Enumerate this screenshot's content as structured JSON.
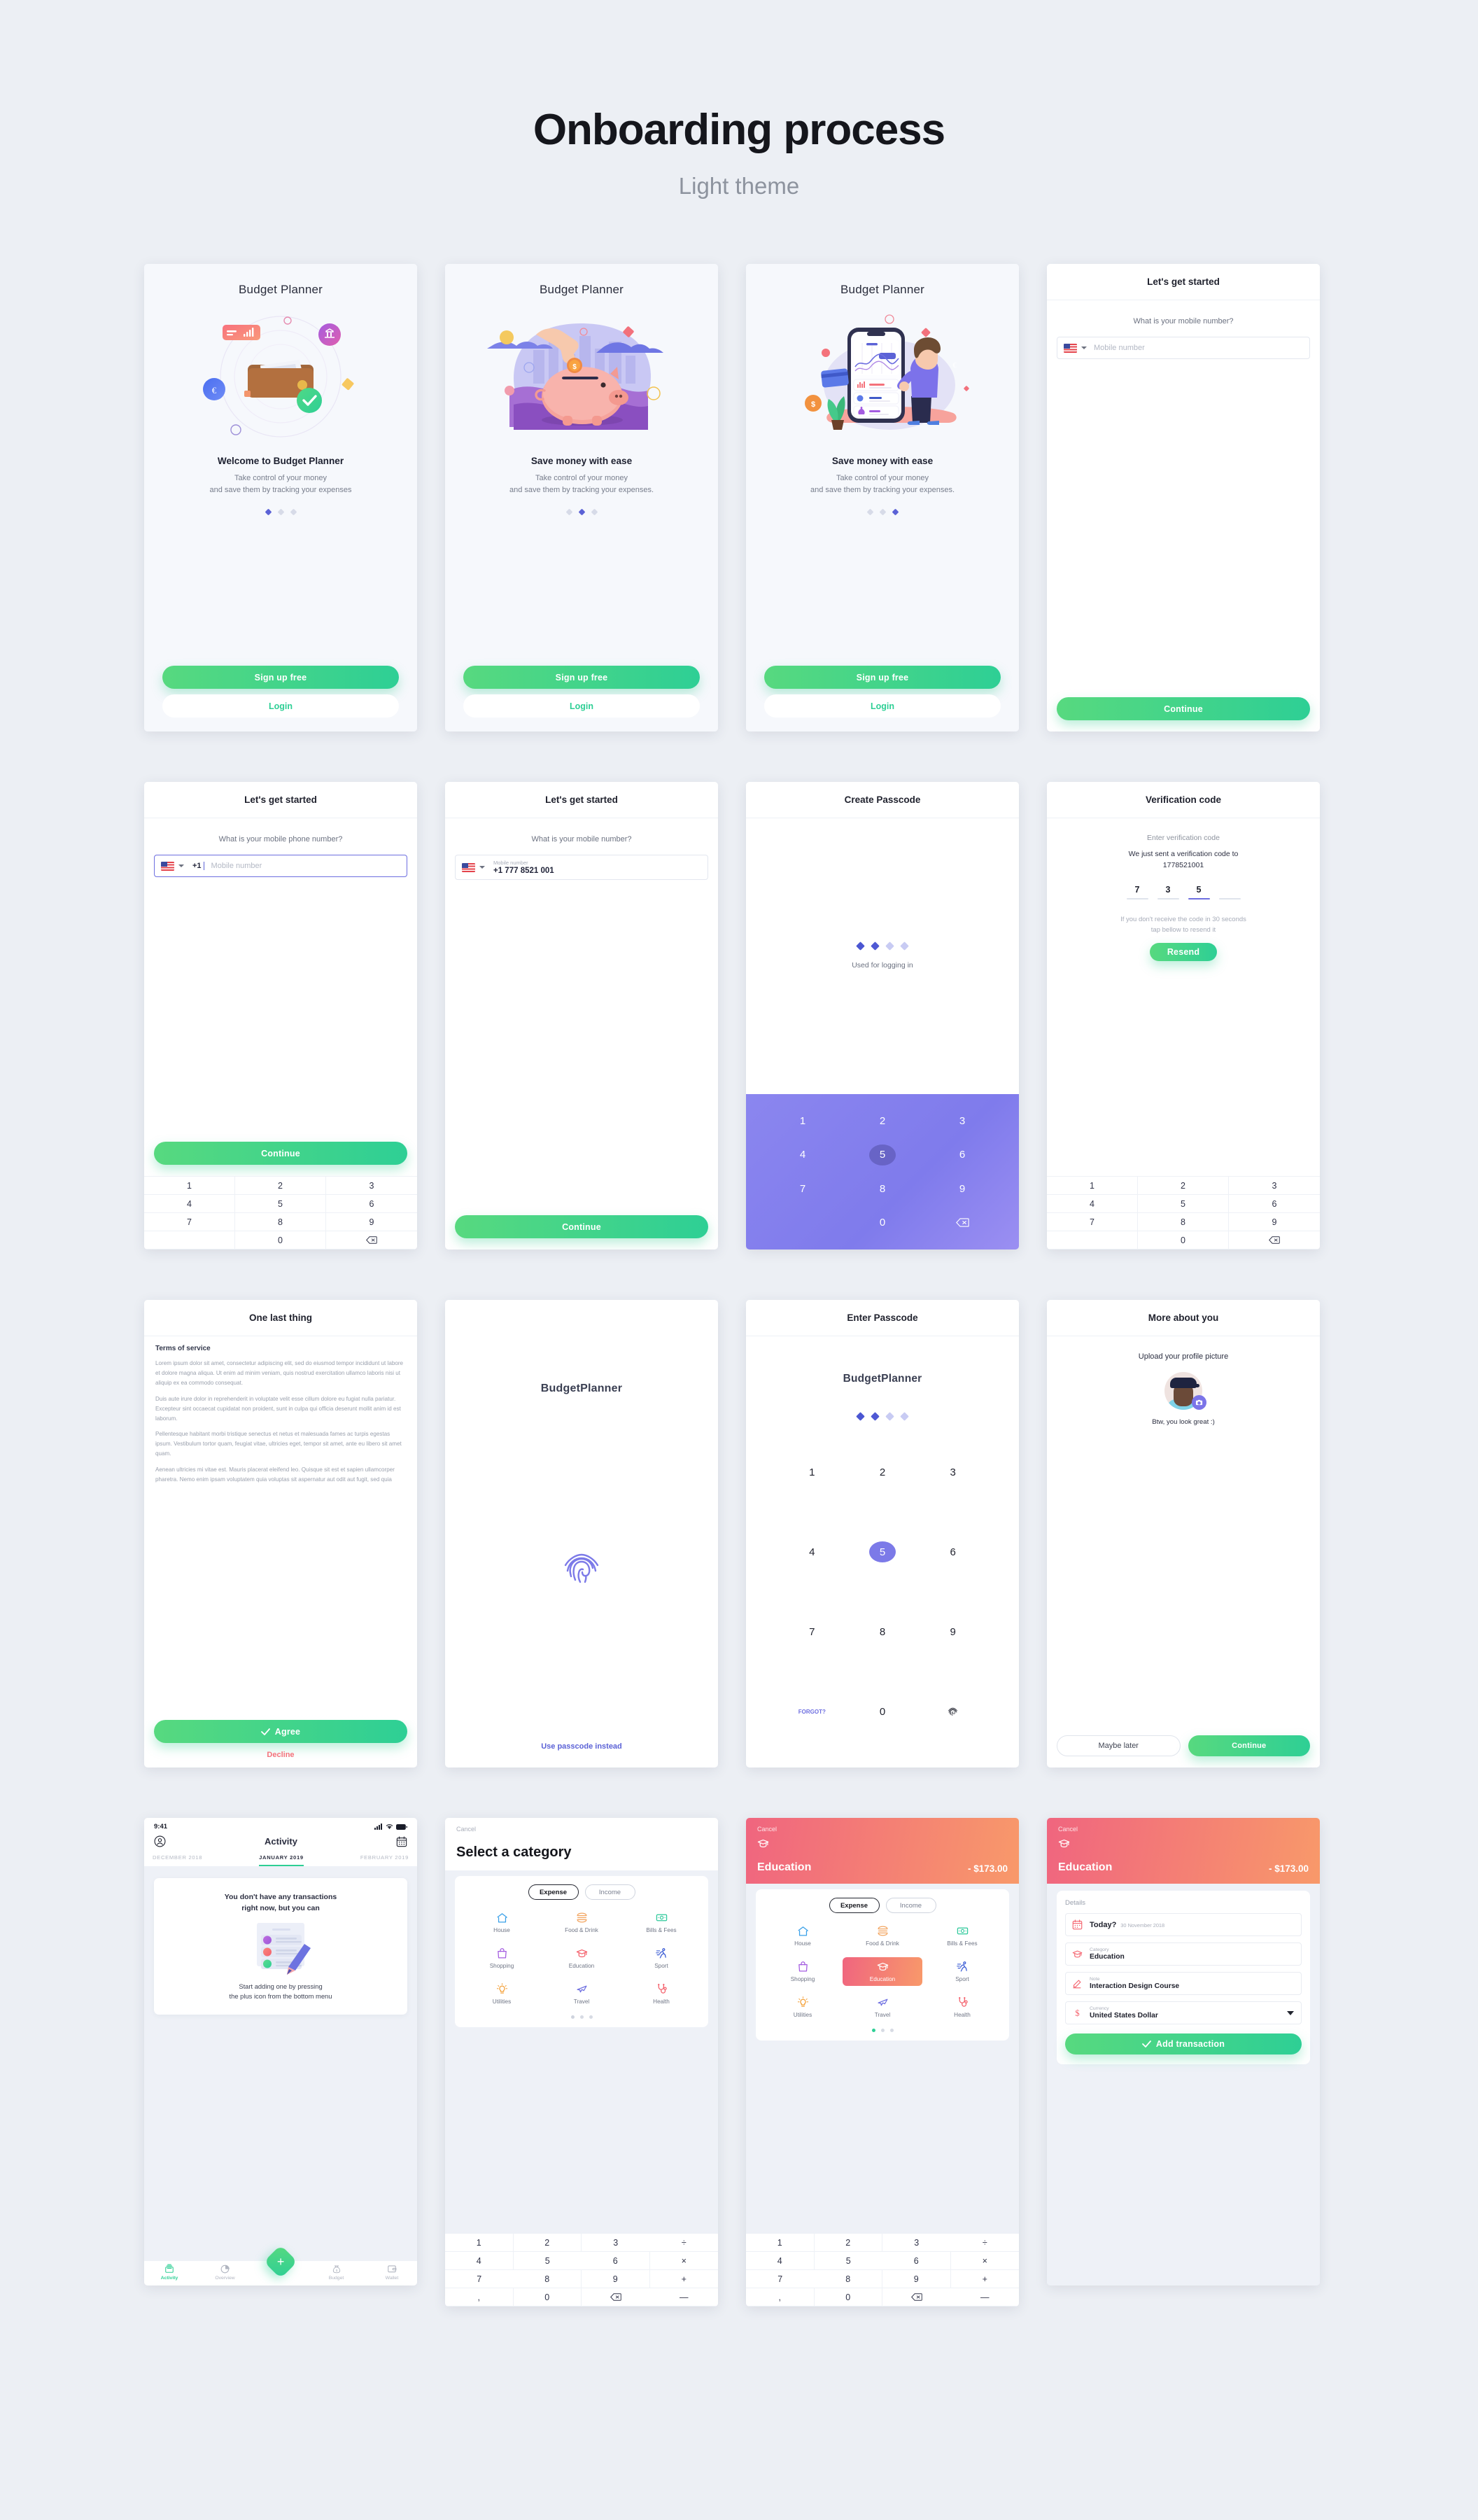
{
  "page": {
    "title": "Onboarding process",
    "subtitle": "Light theme"
  },
  "common": {
    "brand": "Budget Planner",
    "brand_compact": "BudgetPlanner",
    "signup_label": "Sign up free",
    "login_label": "Login",
    "continue_label": "Continue",
    "mobile_placeholder": "Mobile number",
    "mobile_label": "Mobile number",
    "country_code": "+1",
    "accent_green": "#2ecf95",
    "accent_purple": "#6d6ee0",
    "accent_red": "#f4727b"
  },
  "onboarding": [
    {
      "title": "Budget Planner",
      "heading": "Welcome to Budget Planner",
      "body_line1": "Take control of your money",
      "body_line2": "and save them by tracking your expenses",
      "active_dot": 0
    },
    {
      "title": "Budget Planner",
      "heading": "Save money with ease",
      "body_line1": "Take control of your money",
      "body_line2": "and save them by tracking your expenses.",
      "active_dot": 1
    },
    {
      "title": "Budget Planner",
      "heading": "Save money with ease",
      "body_line1": "Take control of your money",
      "body_line2": "and save them by tracking your expenses.",
      "active_dot": 2
    }
  ],
  "get_started_empty": {
    "navbar": "Let's get started",
    "question": "What is your mobile number?",
    "placeholder": "Mobile number",
    "cta": "Continue"
  },
  "get_started_typing": {
    "navbar": "Let's get started",
    "question": "What is your mobile phone number?",
    "prefix": "+1",
    "placeholder": "Mobile number",
    "cta": "Continue"
  },
  "get_started_filled": {
    "navbar": "Let's get started",
    "question": "What is your mobile number?",
    "field_label": "Mobile number",
    "field_value": "+1 777 8521 001",
    "cta": "Continue"
  },
  "create_passcode": {
    "navbar": "Create Passcode",
    "hint": "Used for logging in",
    "filled_dots": 2,
    "total_dots": 4,
    "pressed_key": "5"
  },
  "verification": {
    "navbar": "Verification code",
    "subtitle": "Enter verification code",
    "sent_line1": "We just sent a verification code to",
    "sent_line2": "1778521001",
    "digits": [
      "7",
      "3",
      "5",
      ""
    ],
    "active_index": 2,
    "note_line1": "If you don't receive the code in 30 seconds",
    "note_line2": "tap bellow to resend it",
    "resend_label": "Resend"
  },
  "terms": {
    "navbar": "One last thing",
    "heading": "Terms of service",
    "paragraphs": [
      "Lorem ipsum dolor sit amet, consectetur adipiscing elit, sed do eiusmod tempor incididunt ut labore et dolore magna aliqua. Ut enim ad minim veniam, quis nostrud exercitation ullamco laboris nisi ut aliquip ex ea commodo consequat.",
      "Duis aute irure dolor in reprehenderit in voluptate velit esse cillum dolore eu fugiat nulla pariatur. Excepteur sint occaecat cupidatat non proident, sunt in culpa qui officia deserunt mollit anim id est laborum.",
      "Pellentesque habitant morbi tristique senectus et netus et malesuada fames ac turpis egestas ipsum. Vestibulum tortor quam, feugiat vitae, ultricies eget, tempor sit amet, ante eu libero sit amet quam.",
      "Aenean ultricies mi vitae est. Mauris placerat eleifend leo. Quisque sit est et sapien ullamcorper pharetra. Nemo enim ipsam voluptatem quia voluptas sit aspernatur aut odit aut fugit, sed quia"
    ],
    "agree_label": "Agree",
    "decline_label": "Decline"
  },
  "fingerprint": {
    "brand": "BudgetPlanner",
    "link": "Use passcode instead"
  },
  "enter_passcode": {
    "navbar": "Enter Passcode",
    "brand": "BudgetPlanner",
    "filled_dots": 2,
    "total_dots": 4,
    "forgot_label": "FORGOT?",
    "pressed_key": "5"
  },
  "profile": {
    "navbar": "More about you",
    "prompt": "Upload your profile picture",
    "caption": "Btw, you look great :)",
    "secondary_cta": "Maybe later",
    "primary_cta": "Continue"
  },
  "activity": {
    "status_time": "9:41",
    "title": "Activity",
    "months": [
      "DECEMBER 2018",
      "JANUARY 2019",
      "FEBRUARY 2019"
    ],
    "active_month_index": 1,
    "empty_heading_line1": "You don't have any transactions",
    "empty_heading_line2": "right now, but you can",
    "empty_body_line1": "Start adding one by pressing",
    "empty_body_line2": "the plus icon from the bottom menu",
    "tabs": [
      "Activity",
      "Overview",
      "Budget",
      "Wallet"
    ],
    "active_tab_index": 0
  },
  "category_screen": {
    "cancel": "Cancel",
    "title": "Select a category",
    "segments": [
      "Expense",
      "Income"
    ],
    "active_segment": 0,
    "categories": [
      "House",
      "Food & Drink",
      "Bills & Fees",
      "Shopping",
      "Education",
      "Sport",
      "Utilities",
      "Travel",
      "Health"
    ],
    "selected_category": null,
    "page_count": 3,
    "active_page": 0,
    "keypad": [
      "1",
      "2",
      "3",
      "÷",
      "4",
      "5",
      "6",
      "×",
      "7",
      "8",
      "9",
      "+",
      ",",
      "0",
      "⌫",
      "—"
    ]
  },
  "category_selected_screen": {
    "cancel": "Cancel",
    "category_name": "Education",
    "amount": "- $173.00",
    "segments": [
      "Expense",
      "Income"
    ],
    "active_segment": 0,
    "categories": [
      "House",
      "Food & Drink",
      "Bills & Fees",
      "Shopping",
      "Education",
      "Sport",
      "Utilities",
      "Travel",
      "Health"
    ],
    "selected_category": "Education",
    "page_count": 3,
    "active_page": 0,
    "keypad": [
      "1",
      "2",
      "3",
      "÷",
      "4",
      "5",
      "6",
      "×",
      "7",
      "8",
      "9",
      "+",
      ",",
      "0",
      "⌫",
      "—"
    ]
  },
  "details_screen": {
    "cancel": "Cancel",
    "category_name": "Education",
    "amount": "- $173.00",
    "details_heading": "Details",
    "date_prompt": "Today?",
    "date_value": "30 November 2018",
    "category_label": "Category",
    "category_value": "Education",
    "note_label": "Note",
    "note_value": "Interaction Design Course",
    "currency_label": "Currency",
    "currency_value": "United States Dollar",
    "submit_label": "Add transaction"
  },
  "keypad_digits": [
    "1",
    "2",
    "3",
    "4",
    "5",
    "6",
    "7",
    "8",
    "9",
    "",
    "0",
    "⌫"
  ]
}
